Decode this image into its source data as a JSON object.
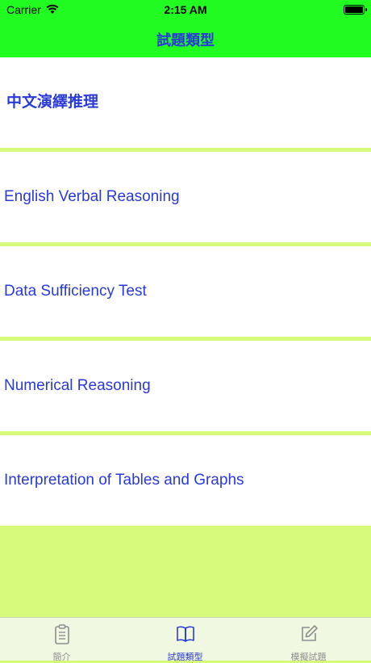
{
  "status_bar": {
    "carrier": "Carrier",
    "time": "2:15 AM"
  },
  "nav": {
    "title": "試題類型"
  },
  "list": {
    "items": [
      {
        "label": "中文演繹推理"
      },
      {
        "label": "English Verbal Reasoning"
      },
      {
        "label": "Data Sufficiency Test"
      },
      {
        "label": "Numerical Reasoning"
      },
      {
        "label": "Interpretation of Tables and Graphs"
      }
    ]
  },
  "tabbar": {
    "tabs": [
      {
        "label": "簡介",
        "icon": "clipboard-icon"
      },
      {
        "label": "試題類型",
        "icon": "book-icon",
        "selected": true
      },
      {
        "label": "模擬試題",
        "icon": "compose-icon"
      }
    ]
  },
  "colors": {
    "nav_background": "#22fb22",
    "page_background": "#d6fa7a",
    "accent_text": "#2a3ad8",
    "inactive_tab": "#8e8e8e"
  }
}
